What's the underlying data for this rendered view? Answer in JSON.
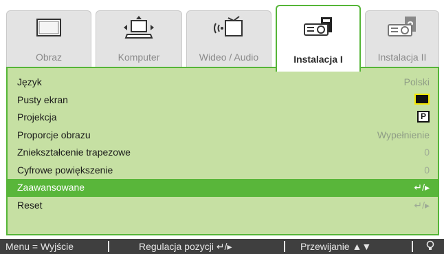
{
  "tabs": [
    {
      "label": "Obraz",
      "icon": "monitor-icon",
      "active": false
    },
    {
      "label": "Komputer",
      "icon": "computer-icon",
      "active": false
    },
    {
      "label": "Wideo / Audio",
      "icon": "video-audio-icon",
      "active": false
    },
    {
      "label": "Instalacja I",
      "icon": "projector-icon",
      "active": true
    },
    {
      "label": "Instalacja II",
      "icon": "projector-settings-icon",
      "active": false
    }
  ],
  "menu": {
    "rows": [
      {
        "label": "Język",
        "value": "Polski"
      },
      {
        "label": "Pusty ekran",
        "value_icon": "black-screen-swatch"
      },
      {
        "label": "Projekcja",
        "value_icon": "P"
      },
      {
        "label": "Proporcje obrazu",
        "value": "Wypełnienie"
      },
      {
        "label": "Zniekształcenie trapezowe",
        "value": "0"
      },
      {
        "label": "Cyfrowe powiększenie",
        "value": "0"
      },
      {
        "label": "Zaawansowane",
        "value": "↵/▸",
        "selected": true
      },
      {
        "label": "Reset",
        "value": "↵/▸"
      }
    ]
  },
  "statusbar": {
    "exit_hint": "Menu = Wyjście",
    "adjust_hint": "Regulacja pozycji ↵/▸",
    "scroll_hint": "Przewijanie ▲▼",
    "bulb_icon": "bulb-icon"
  },
  "colors": {
    "accent_green": "#55b537",
    "panel_bg": "#c6e0a3",
    "selected_row": "#59b63a",
    "statusbar_bg": "#3f3f3f"
  }
}
